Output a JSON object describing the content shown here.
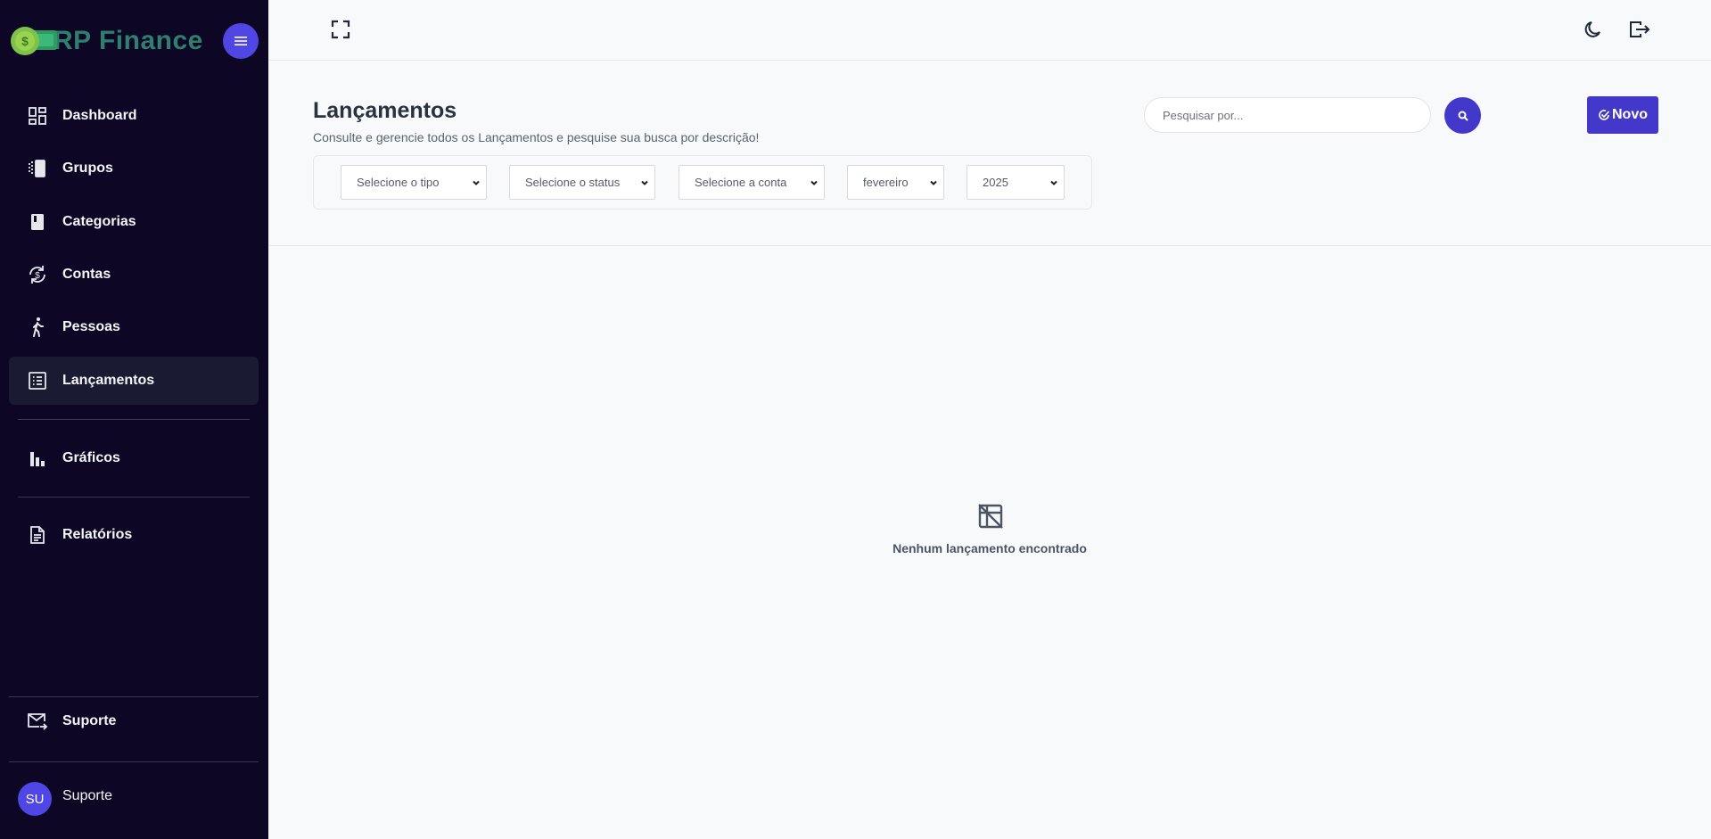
{
  "brand": {
    "name": "RP Finance"
  },
  "sidebar": {
    "items": [
      {
        "label": "Dashboard",
        "icon": "dashboard-icon"
      },
      {
        "label": "Grupos",
        "icon": "groups-icon"
      },
      {
        "label": "Categorias",
        "icon": "book-icon"
      },
      {
        "label": "Contas",
        "icon": "currency-exchange-icon"
      },
      {
        "label": "Pessoas",
        "icon": "person-walking-icon"
      },
      {
        "label": "Lançamentos",
        "icon": "list-icon",
        "active": true
      },
      {
        "label": "Gráficos",
        "icon": "bar-chart-icon"
      },
      {
        "label": "Relatórios",
        "icon": "document-icon"
      }
    ],
    "support": {
      "label": "Suporte",
      "icon": "mail-icon"
    },
    "user": {
      "initials": "SU",
      "name": "Suporte"
    }
  },
  "header": {
    "title": "Lançamentos",
    "subtitle": "Consulte e gerencie todos os Lançamentos e pesquise sua busca por descrição!",
    "search_placeholder": "Pesquisar por...",
    "new_button": "Novo"
  },
  "filters": {
    "tipo": "Selecione o tipo",
    "status": "Selecione o status",
    "conta": "Selecione a conta",
    "mes": "fevereiro",
    "ano": "2025"
  },
  "empty_state": {
    "message": "Nenhum lançamento encontrado"
  },
  "colors": {
    "sidebar_bg": "#0d0624",
    "accent": "#4338ca",
    "brand_text": "#2f7f6f"
  }
}
